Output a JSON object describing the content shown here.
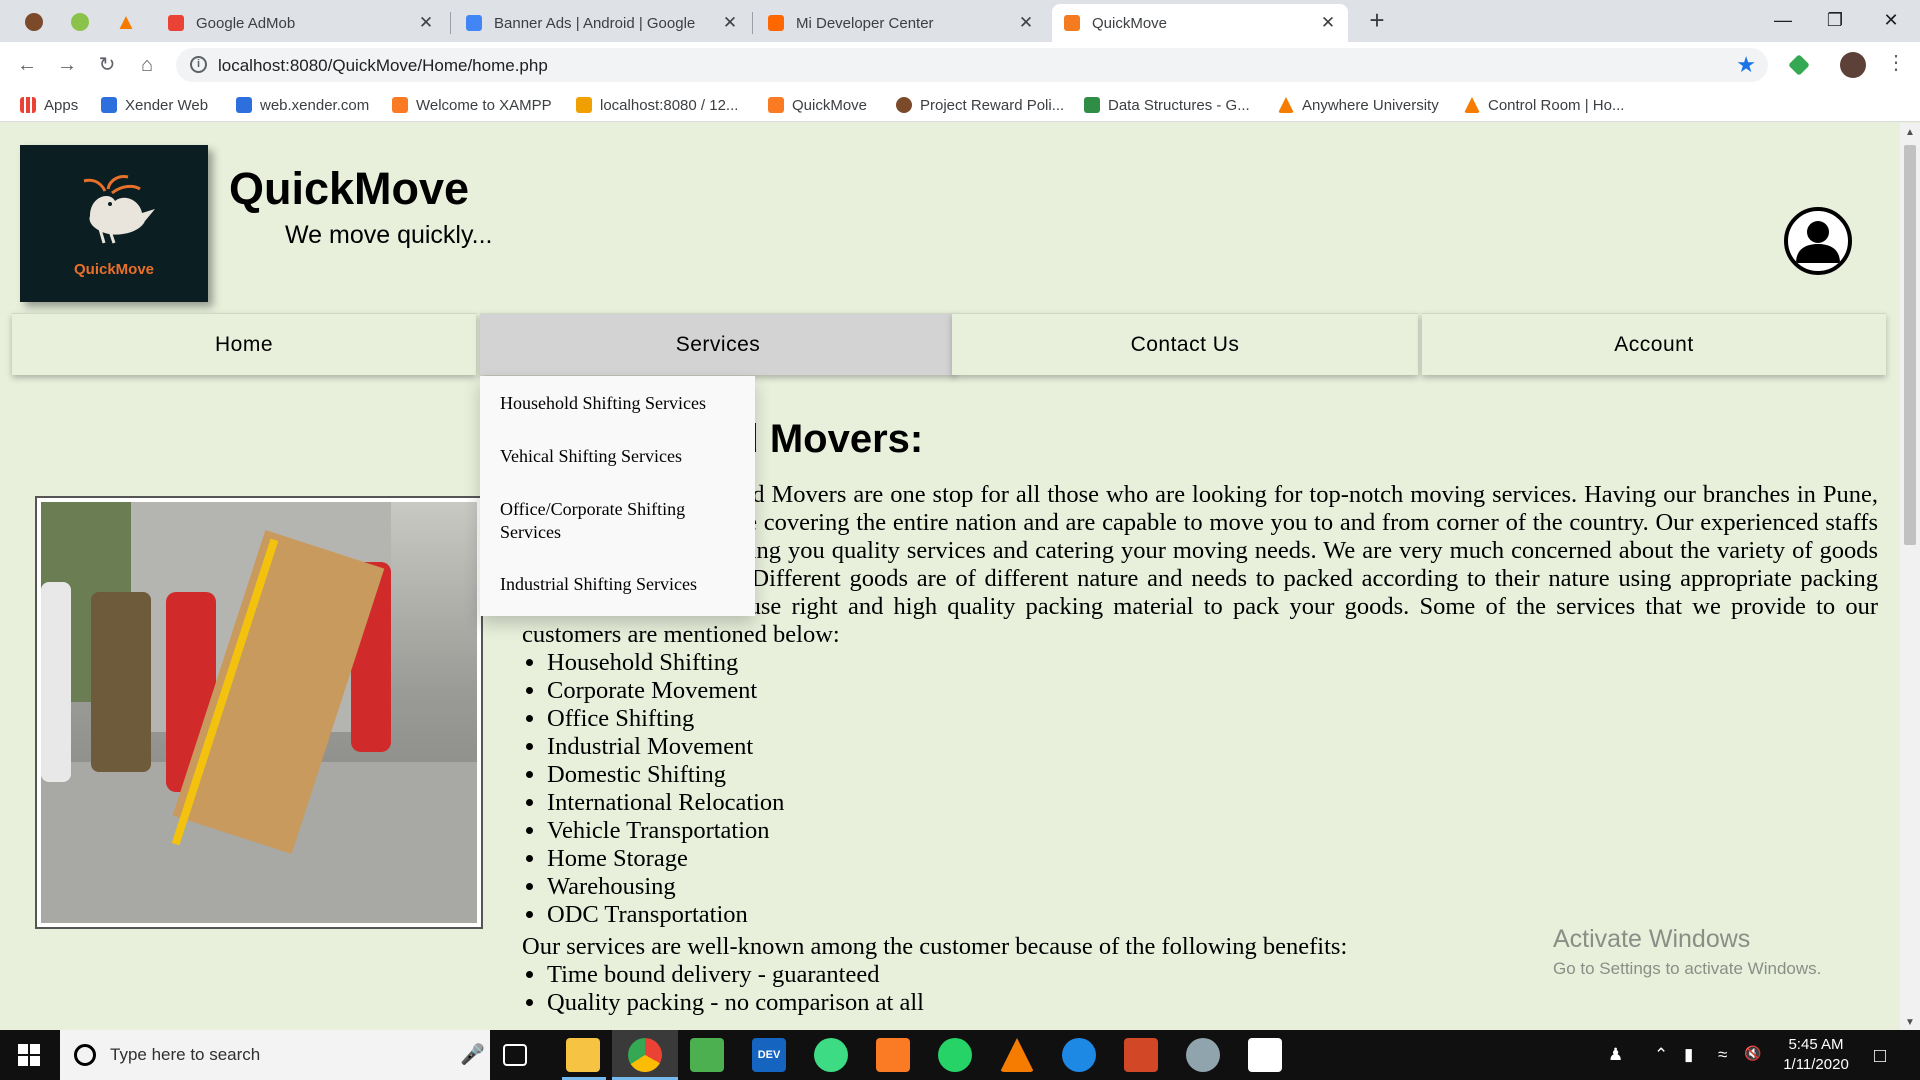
{
  "browser": {
    "tabs": [
      {
        "title": "Google AdMob",
        "favicon_color": "#ea4335"
      },
      {
        "title": "Banner Ads  |  Android  |  Google",
        "favicon_color": "#4285f4"
      },
      {
        "title": "Mi Developer Center",
        "favicon_color": "#ff6700"
      },
      {
        "title": "QuickMove",
        "favicon_color": "#f47b20"
      }
    ],
    "url": "localhost:8080/QuickMove/Home/home.php",
    "bookmarks": [
      {
        "label": "Apps",
        "icon_color": "#4285f4"
      },
      {
        "label": "Xender Web",
        "icon_color": "#2d6fdc"
      },
      {
        "label": "web.xender.com",
        "icon_color": "#2d6fdc"
      },
      {
        "label": "Welcome to XAMPP",
        "icon_color": "#fb7a24"
      },
      {
        "label": "localhost:8080 / 12...",
        "icon_color": "#f0a000"
      },
      {
        "label": "QuickMove",
        "icon_color": "#fb7a24"
      },
      {
        "label": "Project Reward Poli...",
        "icon_color": "#7b4a2a"
      },
      {
        "label": "Data Structures - G...",
        "icon_color": "#2f8d46"
      },
      {
        "label": "Anywhere University",
        "icon_color": "#f57c00"
      },
      {
        "label": "Control Room | Ho...",
        "icon_color": "#f57c00"
      }
    ]
  },
  "site": {
    "logo_text": "QuickMove",
    "title": "QuickMove",
    "tagline": "We move quickly..."
  },
  "nav": {
    "items": [
      "Home",
      "Services",
      "Contact Us",
      "Account"
    ],
    "hovered": "Services",
    "dropdown": [
      "Household Shifting Services",
      "Vehical Shifting Services",
      "Office/Corporate Shifting Services",
      "Industrial Shifting Services"
    ]
  },
  "content": {
    "heading": "Packers and Movers:",
    "intro_line_1": "QuickMove Packers and Movers are one stop for all those who are looking for top-notch moving services. Having our",
    "intro_line_2": "branches in Pune, Goa and Gujarat we are covering the entire nation and are capable to move you to and from corner of",
    "intro_line_3": "the country. Our experienced staffs are proficient in rendering you quality services and catering your moving needs. We are very",
    "intro_line_4": "much concerned about the variety of goods we have at our home. Different goods are of different nature and needs to",
    "intro_line_5": "packed according to their nature using appropriate packing material.We own and use right and high quality packing material to",
    "intro_line_6": "pack your goods. Some of the services that we provide to our customers are mentioned below:",
    "services": [
      "Household Shifting",
      "Corporate Movement",
      "Office Shifting",
      "Industrial Movement",
      "Domestic Shifting",
      "International Relocation",
      "Vehicle Transportation",
      "Home Storage",
      "Warehousing",
      "ODC Transportation"
    ],
    "benefits_intro": "Our services are well-known among the customer because of the following benefits:",
    "benefits": [
      "Time bound delivery - guaranteed",
      "Quality packing - no comparison at all"
    ]
  },
  "watermark": {
    "line1": "Activate Windows",
    "line2": "Go to Settings to activate Windows."
  },
  "taskbar": {
    "search_placeholder": "Type here to search",
    "time": "5:45 AM",
    "date": "1/11/2020",
    "apps": [
      {
        "name": "file-explorer",
        "color": "#f6c342"
      },
      {
        "name": "chrome",
        "color": "#ea4335"
      },
      {
        "name": "image-editor",
        "color": "#4caf50"
      },
      {
        "name": "dev-cpp",
        "color": "#1565c0",
        "label": "DEV"
      },
      {
        "name": "android-studio",
        "color": "#3ddc84"
      },
      {
        "name": "xampp",
        "color": "#fb7a24"
      },
      {
        "name": "whatsapp",
        "color": "#25d366"
      },
      {
        "name": "anywhere",
        "color": "#f57c00"
      },
      {
        "name": "sync",
        "color": "#1e88e5"
      },
      {
        "name": "powerpoint",
        "color": "#d24726"
      },
      {
        "name": "paint",
        "color": "#90a4ae"
      },
      {
        "name": "photos",
        "color": "#ffffff"
      }
    ]
  }
}
